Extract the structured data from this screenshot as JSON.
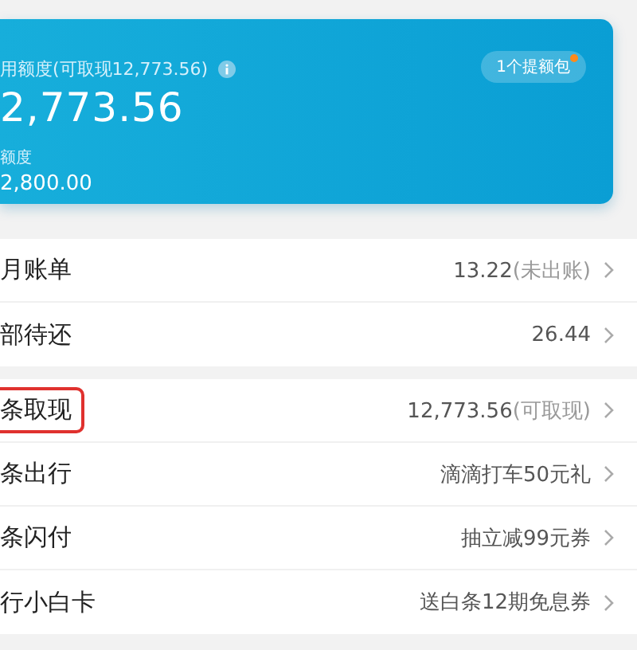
{
  "card": {
    "available_label": "用额度(可取现12,773.56)",
    "available_amount": "2,773.56",
    "total_label": "额度",
    "total_amount": "2,800.00",
    "badge": {
      "label": "1个提额包",
      "dot": true
    }
  },
  "sections": [
    {
      "rows": [
        {
          "label": "月账单",
          "value": "13.22",
          "note": "(未出账)",
          "highlighted": false
        },
        {
          "label": "部待还",
          "value": "26.44",
          "highlighted": false
        }
      ]
    },
    {
      "rows": [
        {
          "label": "条取现",
          "value": "12,773.56",
          "note": "(可取现)",
          "highlighted": true
        },
        {
          "label": "条出行",
          "value": "滴滴打车50元礼",
          "highlighted": false
        },
        {
          "label": "条闪付",
          "value": "抽立减99元券",
          "highlighted": false
        },
        {
          "label": "行小白卡",
          "value": "送白条12期免息券",
          "highlighted": false
        }
      ]
    }
  ]
}
